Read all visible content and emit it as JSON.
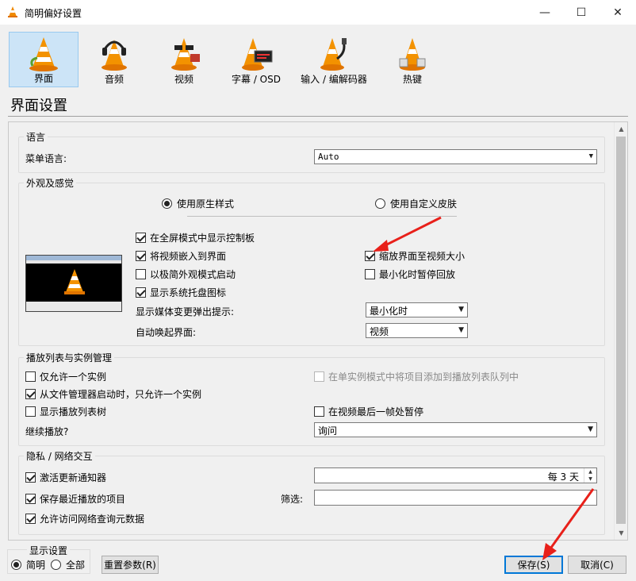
{
  "window": {
    "title": "简明偏好设置",
    "minimize": "—",
    "maximize": "☐",
    "close": "✕"
  },
  "categories": [
    {
      "label": "界面",
      "icon": "vlc-cone-icon",
      "selected": true
    },
    {
      "label": "音频",
      "icon": "headphones-cone-icon"
    },
    {
      "label": "视频",
      "icon": "glasses-cone-icon"
    },
    {
      "label": "字幕 / OSD",
      "icon": "subtitle-cone-icon"
    },
    {
      "label": "输入 / 编解码器",
      "icon": "cable-cone-icon"
    },
    {
      "label": "热键",
      "icon": "hotkey-cone-icon"
    }
  ],
  "page_title": "界面设置",
  "language": {
    "group": "语言",
    "menu_language_label": "菜单语言:",
    "menu_language_value": "Auto"
  },
  "appearance": {
    "group": "外观及感觉",
    "native_style": "使用原生样式",
    "custom_skin": "使用自定义皮肤",
    "show_controls_fullscreen": "在全屏模式中显示控制板",
    "embed_video": "将视频嵌入到界面",
    "minimal_mode": "以极简外观模式启动",
    "systray": "显示系统托盘图标",
    "resize_to_video": "缩放界面至视频大小",
    "pause_minimized": "最小化时暂停回放",
    "media_popup_label": "显示媒体变更弹出提示:",
    "media_popup_value": "最小化时",
    "raise_label": "自动唤起界面:",
    "raise_value": "视频"
  },
  "playlist": {
    "group": "播放列表与实例管理",
    "one_instance": "仅允许一个实例",
    "enqueue_one_instance": "在单实例模式中将项目添加到播放列表队列中",
    "file_manager_one_instance": "从文件管理器启动时，只允许一个实例",
    "show_playlist_tree": "显示播放列表树",
    "pause_last_frame": "在视频最后一帧处暂停",
    "continue_label": "继续播放?",
    "continue_value": "询问"
  },
  "privacy": {
    "group": "隐私 / 网络交互",
    "update_notify": "激活更新通知器",
    "update_interval": "每 3 天",
    "save_recent": "保存最近播放的项目",
    "filter_label": "筛选:",
    "filter_value": "",
    "metadata_access": "允许访问网络查询元数据"
  },
  "footer": {
    "show_settings": "显示设置",
    "simple": "简明",
    "all": "全部",
    "reset": "重置参数(R)",
    "save": "保存(S)",
    "cancel": "取消(C)"
  }
}
